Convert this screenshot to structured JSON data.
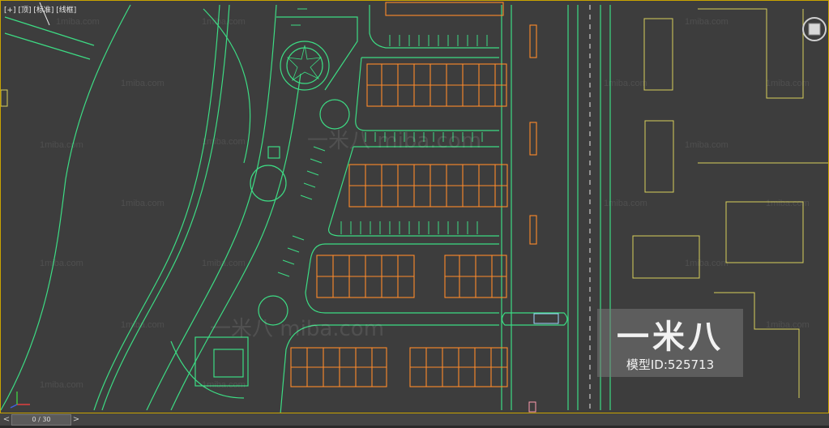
{
  "viewport": {
    "label_plus": "[+]",
    "label_view": "[顶]",
    "label_shading": "[标准]",
    "label_wire": "[线框]"
  },
  "watermarks": {
    "small": "1miba.com",
    "big": "一米八 miba.com"
  },
  "logo": {
    "text": "一米八",
    "model_id": "模型ID:525713"
  },
  "timeline": {
    "prev": "<",
    "frame": "0 / 30",
    "next": ">"
  },
  "colors": {
    "green": "#3ddc84",
    "orange": "#ff8a2a",
    "yellow": "#d8cf5c",
    "white": "#e6e6e6",
    "pink": "#ff9bb0",
    "frame": "#c9a300"
  },
  "icons": {
    "viewcube": "viewcube-icon",
    "axis": "axis-tripod-icon"
  }
}
